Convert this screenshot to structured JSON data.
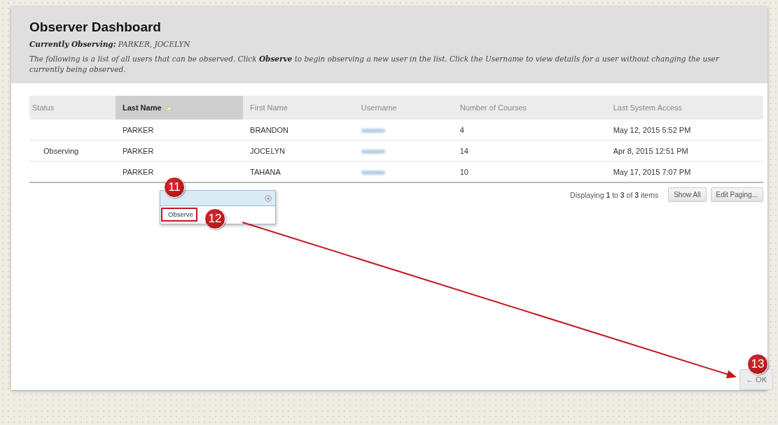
{
  "header": {
    "title": "Observer Dashboard",
    "currently_observing": "**Currently Observing:** PARKER, JOCELYN",
    "instructions": "The following is a list of all users that can be observed. Click **Observe** to begin observing a new user in the list. Click the Username to view details for a user without changing the user currently being observed."
  },
  "table": {
    "columns": [
      {
        "label": "Status",
        "sorted": false
      },
      {
        "label": "Last Name",
        "sorted": true
      },
      {
        "label": "First Name",
        "sorted": false
      },
      {
        "label": "Username",
        "sorted": false
      },
      {
        "label": "Number of Courses",
        "sorted": false
      },
      {
        "label": "Last System Access",
        "sorted": false
      }
    ],
    "rows": [
      {
        "status": "",
        "last_name": "PARKER",
        "first_name": "BRANDON",
        "courses": "4",
        "last_access": "May 12, 2015 5:52 PM"
      },
      {
        "status": "Observing",
        "last_name": "PARKER",
        "first_name": "JOCELYN",
        "courses": "14",
        "last_access": "Apr 8, 2015 12:51 PM"
      },
      {
        "status": "",
        "last_name": "PARKER",
        "first_name": "TAHANA",
        "courses": "10",
        "last_access": "May 17, 2015 7:07 PM"
      }
    ]
  },
  "context_menu": {
    "items": [
      {
        "label": "Observe",
        "highlighted": true
      }
    ]
  },
  "paging": {
    "summary": "Displaying **1** to **3** of **3** items",
    "buttons": [
      "Show All",
      "Edit Paging..."
    ]
  },
  "callouts": [
    "11",
    "12",
    "13"
  ],
  "ok_button": "← OK"
}
